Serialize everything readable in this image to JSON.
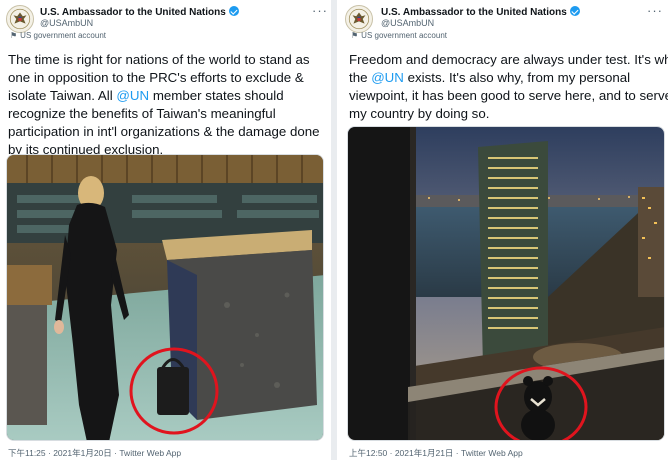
{
  "tweets": [
    {
      "account_name": "U.S. Ambassador to the United Nations",
      "handle": "@USAmbUN",
      "label": "US government account",
      "text_lines": [
        [
          "The time is right for nations of the world to stand as"
        ],
        [
          "one in opposition to the PRC's efforts to exclude &"
        ],
        [
          "isolate Taiwan. All ",
          "@UN",
          " member states should"
        ],
        [
          "recognize the benefits of Taiwan's meaningful"
        ],
        [
          "participation in int'l organizations & the damage done"
        ],
        [
          "by its continued exclusion."
        ]
      ],
      "meta": "下午11:25 · 2021年1月20日 · Twitter Web App"
    },
    {
      "account_name": "U.S. Ambassador to the United Nations",
      "handle": "@USAmbUN",
      "label": "US government account",
      "text_lines": [
        [
          "Freedom and democracy are always under test. It's why"
        ],
        [
          "the ",
          "@UN",
          " exists. It's also why, from my personal"
        ],
        [
          "viewpoint, it has been good to serve here, and to serve"
        ],
        [
          "my country by doing so."
        ]
      ],
      "meta": "上午12:50 · 2021年1月21日 · Twitter Web App"
    }
  ],
  "colors": {
    "link": "#1d9bf0",
    "verified": "#1d9bf0",
    "annotation_circle": "#e0141e"
  },
  "icons": {
    "verified": "verified-badge-icon",
    "more": "more-options-icon",
    "flag": "flag-icon",
    "seal": "us-seal-icon"
  }
}
